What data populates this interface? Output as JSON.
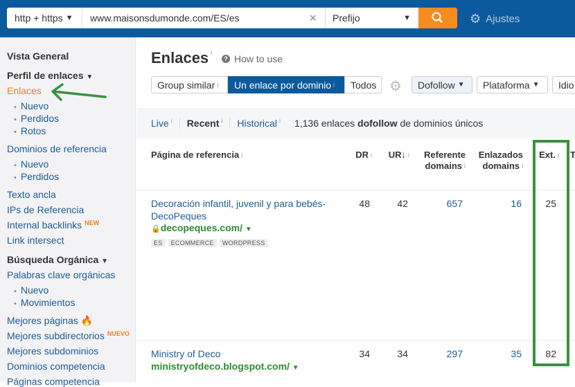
{
  "search": {
    "protocol": "http + https",
    "url": "www.maisonsdumonde.com/ES/es",
    "mode": "Prefijo",
    "settings": "Ajustes"
  },
  "sidebar": {
    "overview": "Vista General",
    "backlink_profile": "Perfil de enlaces",
    "links": "Enlaces",
    "links_sub": [
      "Nuevo",
      "Perdidos",
      "Rotos"
    ],
    "ref_domains": "Dominios de referencia",
    "ref_sub": [
      "Nuevo",
      "Perdidos"
    ],
    "anchor": "Texto ancla",
    "ips": "IPs de Referencia",
    "internal": "Internal backlinks",
    "internal_badge": "NEW",
    "intersect": "Link intersect",
    "organic": "Búsqueda Orgánica",
    "keywords": "Palabras clave orgánicas",
    "kw_sub": [
      "Nuevo",
      "Movimientos"
    ],
    "top_pages": "Mejores páginas",
    "top_subdirs": "Mejores subdirectorios",
    "subdirs_badge": "NUEVO",
    "top_subdomains": "Mejores subdominios",
    "competitors": "Dominios competencia",
    "comp_pages": "Páginas competencia"
  },
  "main": {
    "title": "Enlaces",
    "info": "i",
    "how_to": "How to use",
    "groups": [
      "Group similar",
      "Un enlace por dominio",
      "Todos"
    ],
    "filters": [
      "Dofollow",
      "Plataforma",
      "Idio"
    ],
    "modes": [
      "Live",
      "Recent",
      "Historical"
    ],
    "summary_count": "1,136 enlaces",
    "summary_bold": "dofollow",
    "summary_rest": "de dominios únicos"
  },
  "table": {
    "headers": [
      "Página de referencia",
      "DR",
      "UR",
      "Referente domains",
      "Enlazados domains",
      "Ext.",
      "T"
    ],
    "rows": [
      {
        "title": "Decoración infantil, juvenil y para bebés- DecoPeques",
        "domain": "decopeques.com/",
        "secure": true,
        "tags": [
          "ES",
          "ECOMMERCE",
          "WORDPRESS"
        ],
        "dr": "48",
        "ur": "42",
        "ref": "657",
        "linked": "16",
        "ext": "25"
      },
      {
        "title": "Ministry of Deco",
        "domain": "ministryofdeco.blogspot.com/",
        "secure": false,
        "tags": [],
        "dr": "34",
        "ur": "34",
        "ref": "297",
        "linked": "35",
        "ext": "82"
      }
    ]
  },
  "colors": {
    "topbar": "#0b5a9e",
    "accent": "#f78b1f",
    "annotation": "#3a913f",
    "domain": "#2e8a32"
  }
}
